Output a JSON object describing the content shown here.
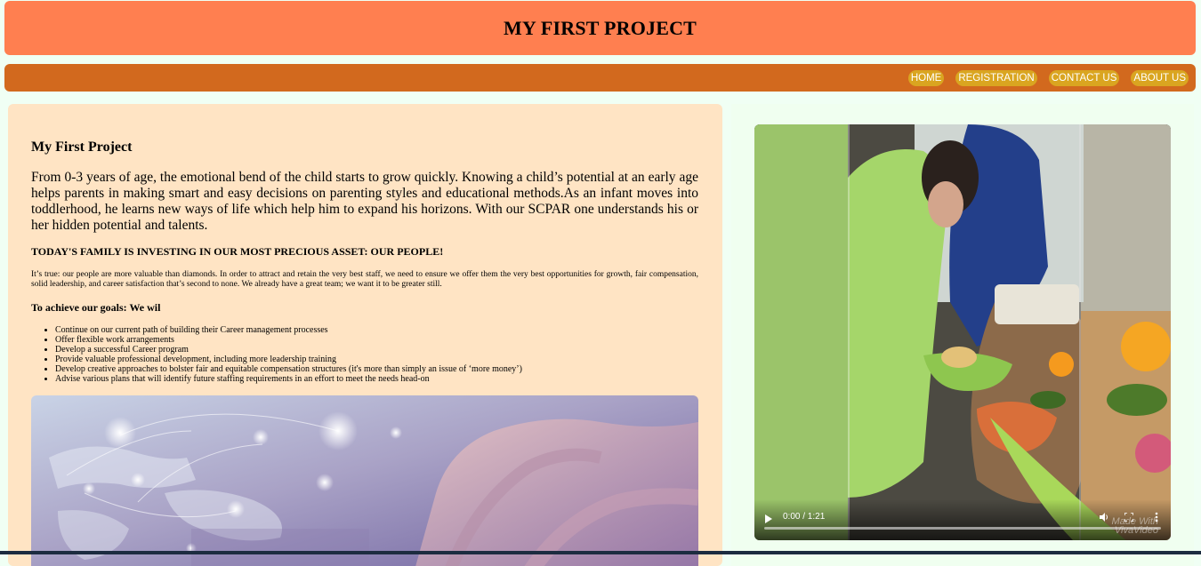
{
  "header": {
    "title": "MY FIRST PROJECT"
  },
  "nav": {
    "items": [
      "HOME",
      "REGISTRATION",
      "CONTACT US",
      "ABOUT US"
    ]
  },
  "main": {
    "heading": "My First Project",
    "intro": "From 0-3 years of age, the emotional bend of the child starts to grow quickly. Knowing a child’s potential at an early age helps parents in making smart and easy decisions on parenting styles and educational methods.As an infant moves into toddlerhood, he learns new ways of life which help him to expand his horizons. With our SCPAR one understands his or her hidden potential and talents.",
    "subheading": "TODAY'S FAMILY IS INVESTING IN OUR MOST PRECIOUS ASSET: OUR PEOPLE!",
    "paragraph": "It’s true: our people are more valuable than diamonds. In order to attract and retain the very best staff, we need to ensure we offer them the very best opportunities for growth, fair compensation, solid leadership, and career satisfaction that’s second to none. We already have a great team; we want it to be greater still.",
    "goals_heading": "To achieve our goals: We wil",
    "goals": [
      "Continue on our current path of building their Career management processes",
      "Offer flexible work arrangements",
      "Develop a successful Career program",
      "Provide valuable professional development, including more leadership training",
      "Develop creative approaches to bolster fair and equitable compensation structures (it's more than simply an issue of ‘more money’)",
      "Advise various plans that will identify future staffing requirements in an effort to meet the needs head-on"
    ]
  },
  "video": {
    "time": "0:00 / 1:21",
    "watermark_line1": "Made With",
    "watermark_line2": "VivaVideo",
    "progress": 0
  },
  "colors": {
    "header": "#ff7f50",
    "nav": "#d2691e",
    "nav_button": "#daa520",
    "left_panel": "#ffe4c4",
    "right_panel": "#f0fff0"
  }
}
